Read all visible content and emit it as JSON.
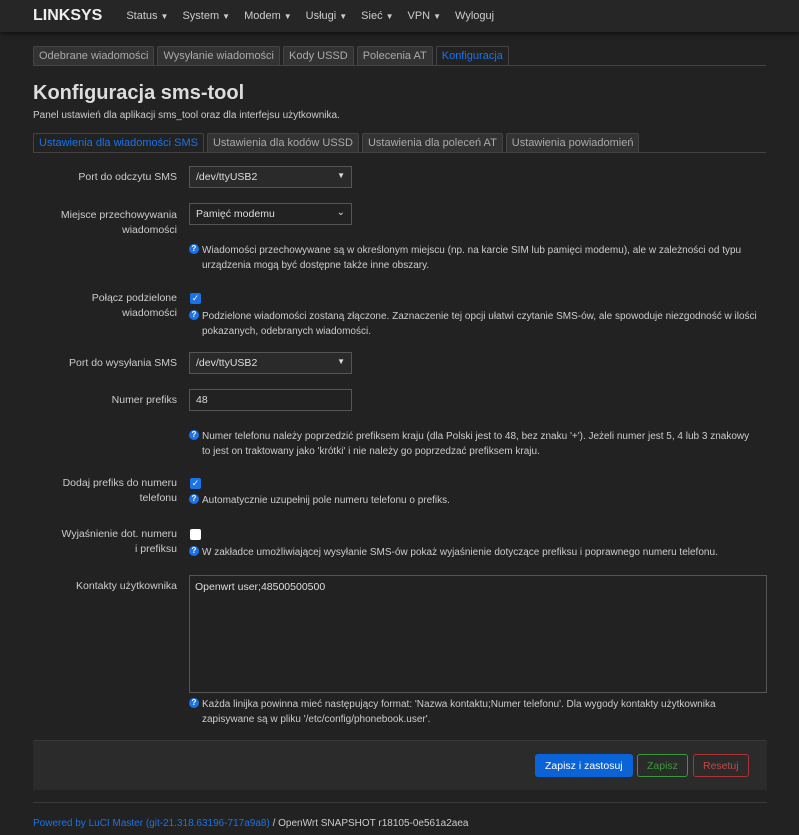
{
  "brand": "LINKSYS",
  "menu": [
    "Status",
    "System",
    "Modem",
    "Usługi",
    "Sieć",
    "VPN",
    "Wyloguj"
  ],
  "tabs": [
    "Odebrane wiadomości",
    "Wysyłanie wiadomości",
    "Kody USSD",
    "Polecenia AT",
    "Konfiguracja"
  ],
  "title": "Konfiguracja sms-tool",
  "subtitle": "Panel ustawień dla aplikacji sms_tool oraz dla interfejsu użytkownika.",
  "subtabs": [
    "Ustawienia dla wiadomości SMS",
    "Ustawienia dla kodów USSD",
    "Ustawienia dla poleceń AT",
    "Ustawienia powiadomień"
  ],
  "form": {
    "read_port": {
      "label": "Port do odczytu SMS",
      "value": "/dev/ttyUSB2"
    },
    "storage": {
      "label": "Miejsce przechowywania wiadomości",
      "value": "Pamięć modemu",
      "help": "Wiadomości przechowywane są w określonym miejscu (np. na karcie SIM lub pamięci modemu), ale w zależności od typu urządzenia mogą być dostępne także inne obszary."
    },
    "merge": {
      "label": "Połącz podzielone wiadomości",
      "checked": true,
      "help": "Podzielone wiadomości zostaną złączone. Zaznaczenie tej opcji ułatwi czytanie SMS-ów, ale spowoduje niezgodność w ilości pokazanych, odebranych wiadomości."
    },
    "send_port": {
      "label": "Port do wysyłania SMS",
      "value": "/dev/ttyUSB2"
    },
    "prefix": {
      "label": "Numer prefiks",
      "value": "48",
      "help": "Numer telefonu należy poprzedzić prefiksem kraju (dla Polski jest to 48, bez znaku '+'). Jeżeli numer jest 5, 4 lub 3 znakowy to jest on traktowany jako 'krótki' i nie należy go poprzedzać prefiksem kraju."
    },
    "add_prefix": {
      "label": "Dodaj prefiks do numeru telefonu",
      "checked": true,
      "help": "Automatycznie uzupełnij pole numeru telefonu o prefiks."
    },
    "explain": {
      "label": "Wyjaśnienie dot. numeru i prefiksu",
      "checked": false,
      "help": "W zakładce umożliwiającej wysyłanie SMS-ów pokaż wyjaśnienie dotyczące prefiksu i poprawnego numeru telefonu."
    },
    "contacts": {
      "label": "Kontakty użytkownika",
      "value": "Openwrt user;48500500500",
      "help": "Każda linijka powinna mieć następujący format: 'Nazwa kontaktu;Numer telefonu'. Dla wygody kontakty użytkownika zapisywane są w pliku '/etc/config/phonebook.user'."
    }
  },
  "buttons": {
    "apply": "Zapisz i zastosuj",
    "save": "Zapisz",
    "reset": "Resetuj"
  },
  "footer": {
    "link": "Powered by LuCI Master (git-21.318.63196-717a9a8)",
    "text": " / OpenWrt SNAPSHOT r18105-0e561a2aea"
  }
}
